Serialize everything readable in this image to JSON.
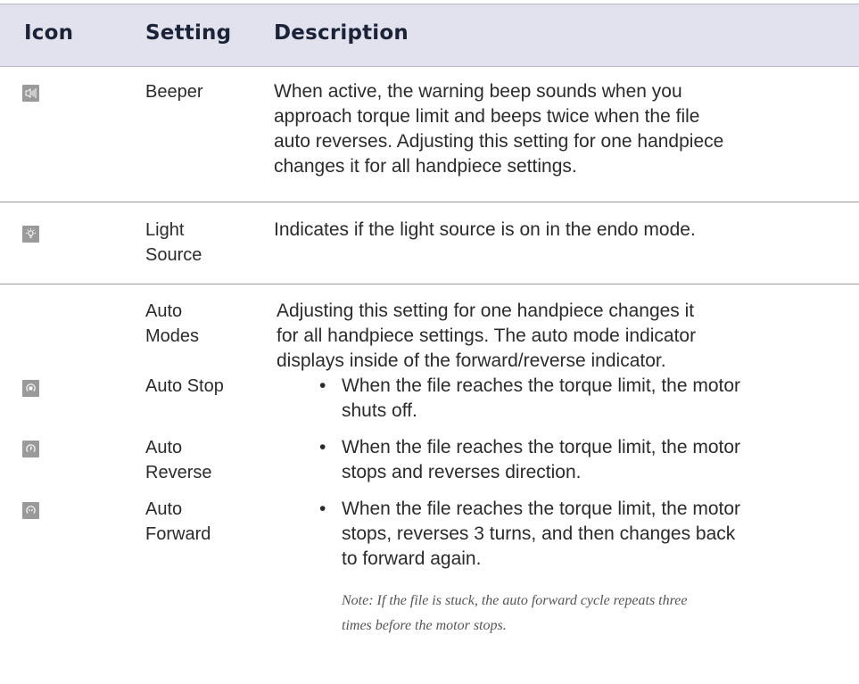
{
  "header": {
    "icon": "Icon",
    "setting": "Setting",
    "description": "Description"
  },
  "rows": [
    {
      "icon": "speaker-icon",
      "setting_lines": [
        "Beeper"
      ],
      "description_lines": [
        "When active, the warning beep sounds when you",
        "approach torque limit and beeps twice when the file",
        "auto reverses. Adjusting this setting for one handpiece",
        "changes it for all handpiece settings."
      ]
    },
    {
      "icon": "light-bulb-icon",
      "setting_lines": [
        "Light",
        "Source"
      ],
      "description_lines": [
        "Indicates if the light source is on in the endo mode."
      ]
    },
    {
      "icon": "",
      "setting_lines": [
        "Auto",
        "Modes"
      ],
      "description_lines": [
        "Adjusting this setting for one handpiece changes it",
        "for all handpiece settings. The auto mode indicator",
        "displays inside of the forward/reverse indicator."
      ]
    },
    {
      "icon": "auto-stop-icon",
      "setting_lines": [
        "Auto Stop"
      ],
      "bullet": "•",
      "description_lines": [
        "When the file reaches the torque limit, the motor",
        "shuts off."
      ]
    },
    {
      "icon": "auto-reverse-icon",
      "setting_lines": [
        "Auto",
        "Reverse"
      ],
      "bullet": "•",
      "description_lines": [
        "When the file reaches the torque limit, the motor",
        "stops and reverses direction."
      ]
    },
    {
      "icon": "auto-forward-icon",
      "setting_lines": [
        "Auto",
        "Forward"
      ],
      "bullet": "•",
      "description_lines": [
        "When the file reaches the torque limit, the motor",
        "stops, reverses 3 turns, and then changes back",
        "to forward again."
      ]
    }
  ],
  "note_lines": [
    "Note:  If the file is stuck, the auto forward cycle repeats three",
    "times before the motor stops."
  ]
}
